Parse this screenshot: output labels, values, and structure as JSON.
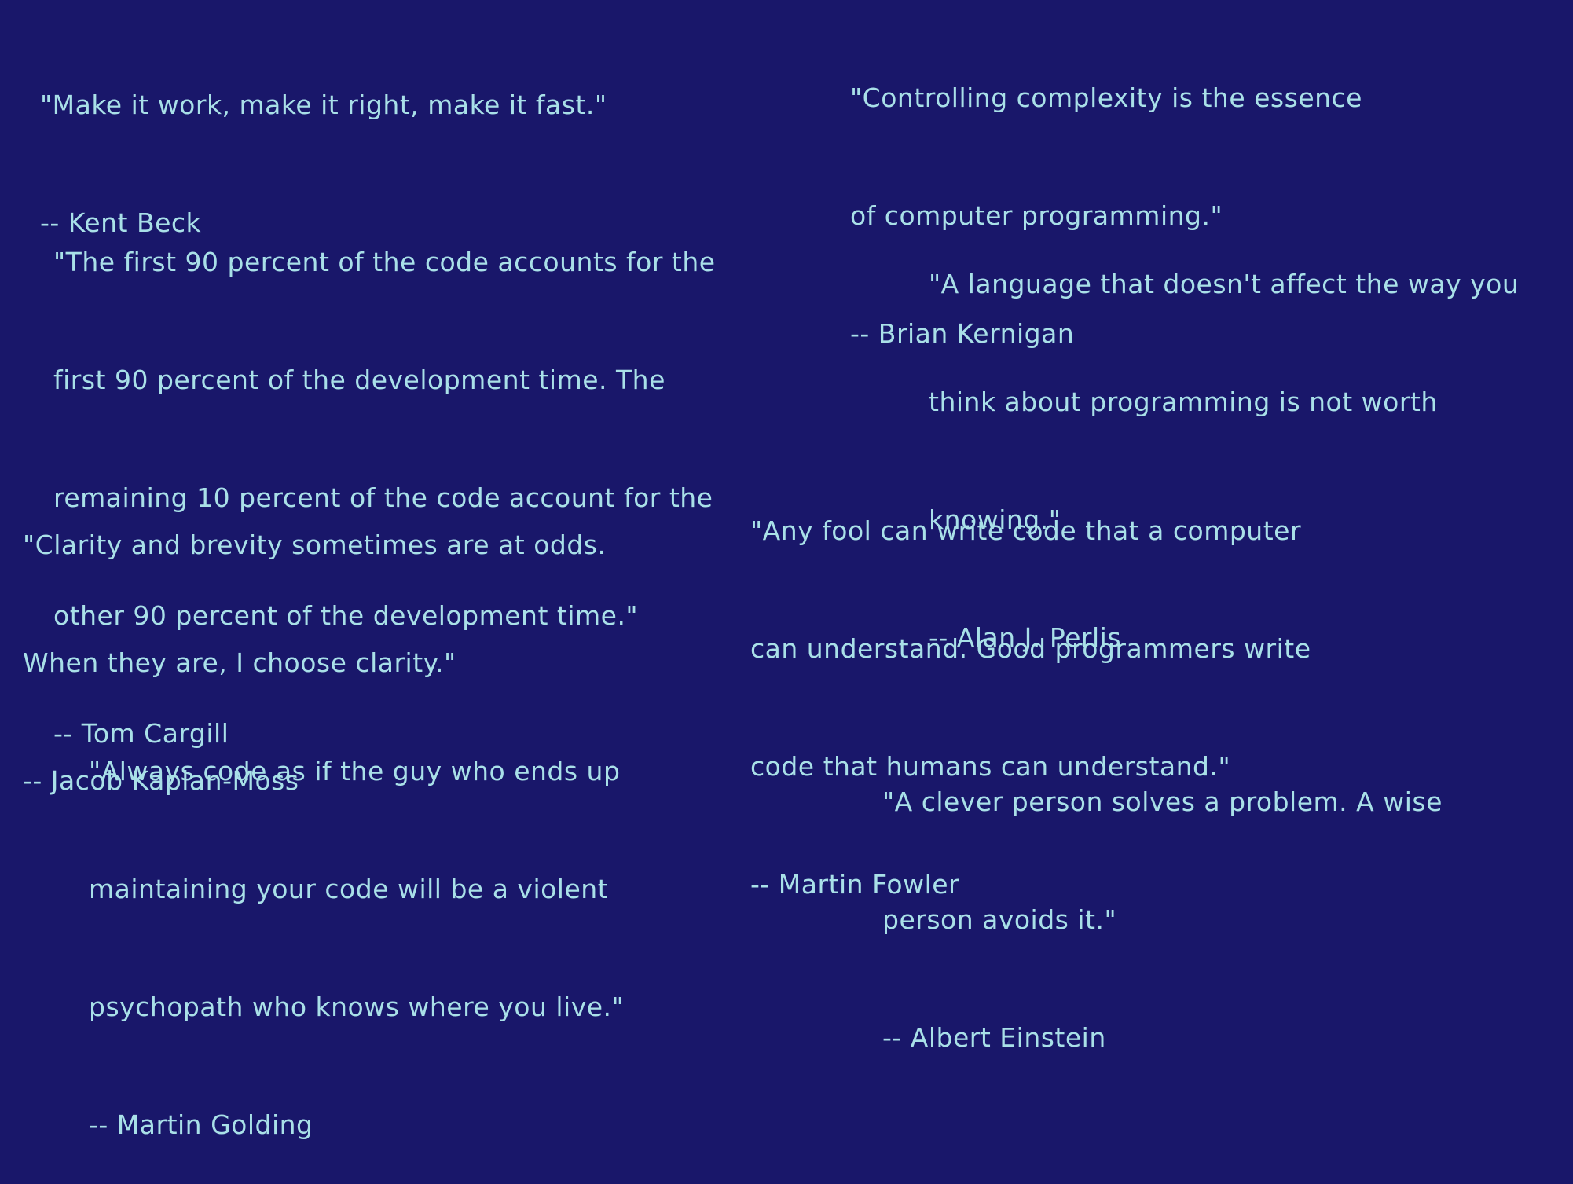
{
  "background_color": "#19176a",
  "text_color": "#a9e0e8",
  "quotes": [
    {
      "lines": [
        "\"Make it work, make it right, make it fast.\""
      ],
      "attribution": "-- Kent Beck"
    },
    {
      "lines": [
        "\"Controlling complexity is the essence",
        "of computer programming.\""
      ],
      "attribution": "-- Brian Kernigan"
    },
    {
      "lines": [
        "\"The first 90 percent of the code accounts for the",
        "first 90 percent of the development time. The",
        "remaining 10 percent of the code account for the",
        "other 90 percent of the development time.\""
      ],
      "attribution": "-- Tom Cargill"
    },
    {
      "lines": [
        "\"A language that doesn't affect the way you",
        "think about programming is not worth",
        "knowing.\""
      ],
      "attribution": "-- Alan J. Perlis"
    },
    {
      "lines": [
        "\"Clarity and brevity sometimes are at odds.",
        "When they are, I choose clarity.\""
      ],
      "attribution": "-- Jacob Kaplan-Moss"
    },
    {
      "lines": [
        "\"Any fool can write code that a computer",
        "can understand. Good programmers write",
        "code that humans can understand.\""
      ],
      "attribution": "-- Martin Fowler"
    },
    {
      "lines": [
        "\"Always code as if the guy who ends up",
        "maintaining your code will be a violent",
        "psychopath who knows where you live.\""
      ],
      "attribution": "-- Martin Golding"
    },
    {
      "lines": [
        "\"A clever person solves a problem. A wise",
        "person avoids it.\""
      ],
      "attribution": "-- Albert Einstein"
    }
  ]
}
